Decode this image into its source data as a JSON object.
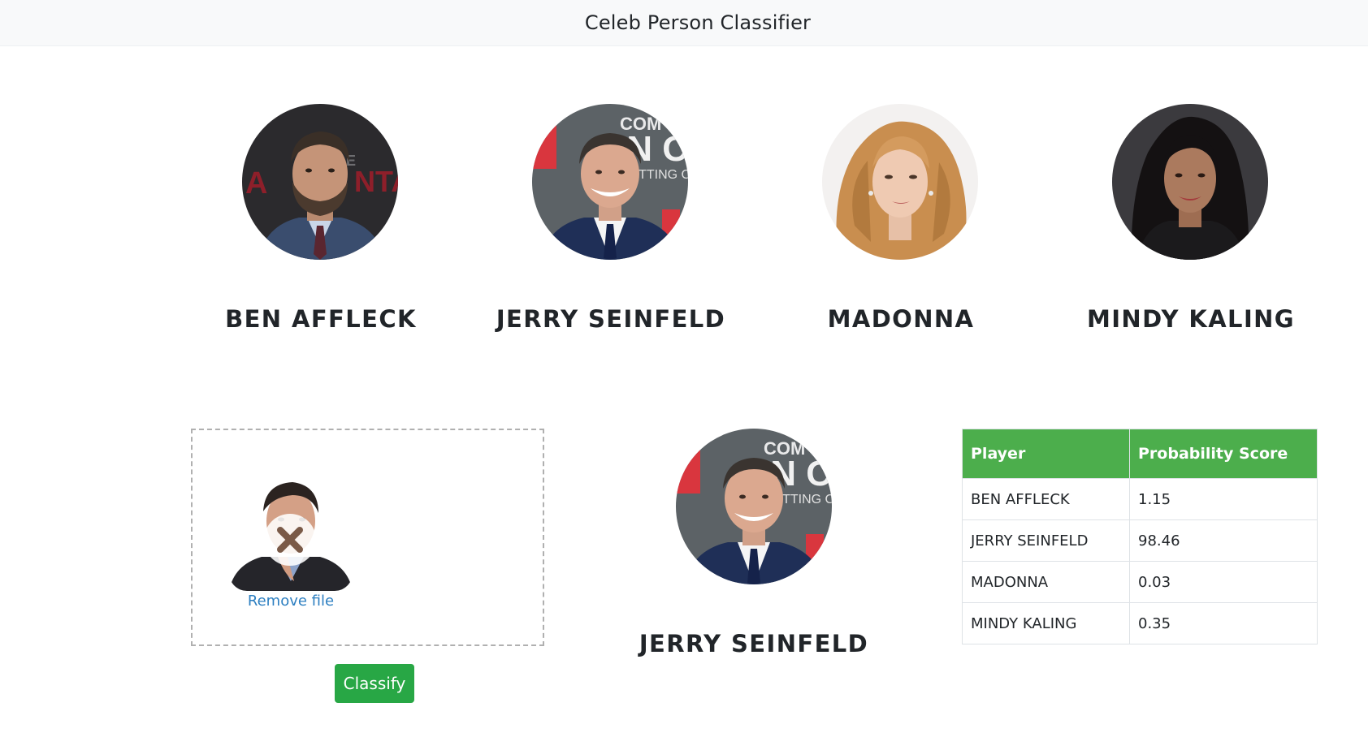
{
  "navbar": {
    "title": "Celeb Person Classifier"
  },
  "celebrities": [
    {
      "name": "BEN AFFLECK"
    },
    {
      "name": "JERRY SEINFELD"
    },
    {
      "name": "MADONNA"
    },
    {
      "name": "MINDY KALING"
    }
  ],
  "dropzone": {
    "remove_label": "Remove file"
  },
  "classify_button": {
    "label": "Classify"
  },
  "result": {
    "name": "JERRY SEINFELD"
  },
  "table": {
    "headers": [
      "Player",
      "Probability Score"
    ],
    "rows": [
      {
        "player": "BEN AFFLECK",
        "score": "1.15"
      },
      {
        "player": "JERRY SEINFELD",
        "score": "98.46"
      },
      {
        "player": "MADONNA",
        "score": "0.03"
      },
      {
        "player": "MINDY KALING",
        "score": "0.35"
      }
    ]
  },
  "colors": {
    "navbar_bg": "#f8f9fa",
    "button_green": "#28a745",
    "table_header_green": "#4cae4c",
    "link_blue": "#2d7fc1"
  }
}
